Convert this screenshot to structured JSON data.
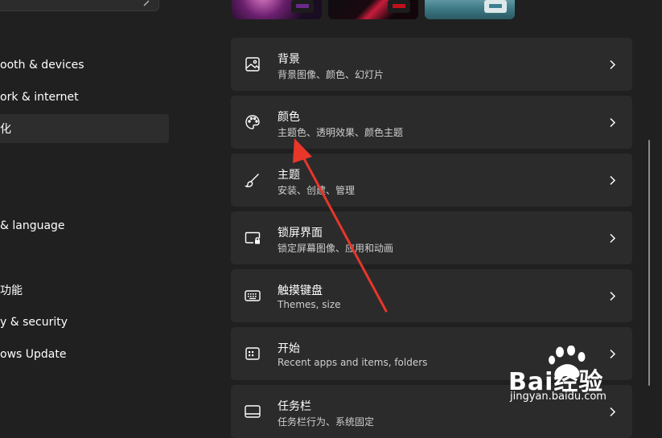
{
  "sidebar": {
    "items": [
      {
        "label": "ooth & devices"
      },
      {
        "label": "ork & internet"
      },
      {
        "label": "化",
        "selected": true
      },
      {
        "label": "& language"
      },
      {
        "label": "功能"
      },
      {
        "label": "y & security"
      },
      {
        "label": "ows Update"
      }
    ]
  },
  "theme_previews": {
    "accent_colors": [
      "#6a2a8a",
      "#c0101c",
      "#3c7f93"
    ]
  },
  "settings": [
    {
      "title": "背景",
      "subtitle": "背景图像、颜色、幻灯片",
      "icon": "image-icon"
    },
    {
      "title": "颜色",
      "subtitle": "主题色、透明效果、颜色主题",
      "icon": "palette-icon"
    },
    {
      "title": "主题",
      "subtitle": "安装、创建、管理",
      "icon": "brush-icon"
    },
    {
      "title": "锁屏界面",
      "subtitle": "锁定屏幕图像、应用和动画",
      "icon": "lock-screen-icon"
    },
    {
      "title": "触摸键盘",
      "subtitle": "Themes, size",
      "icon": "keyboard-icon"
    },
    {
      "title": "开始",
      "subtitle": "Recent apps and items, folders",
      "icon": "start-icon"
    },
    {
      "title": "任务栏",
      "subtitle": "任务栏行为、系统固定",
      "icon": "taskbar-icon"
    }
  ],
  "annotation": {
    "color": "#e8362b"
  },
  "watermark": {
    "brand": "Bai经验",
    "site": "jingyan.baidu.com"
  }
}
